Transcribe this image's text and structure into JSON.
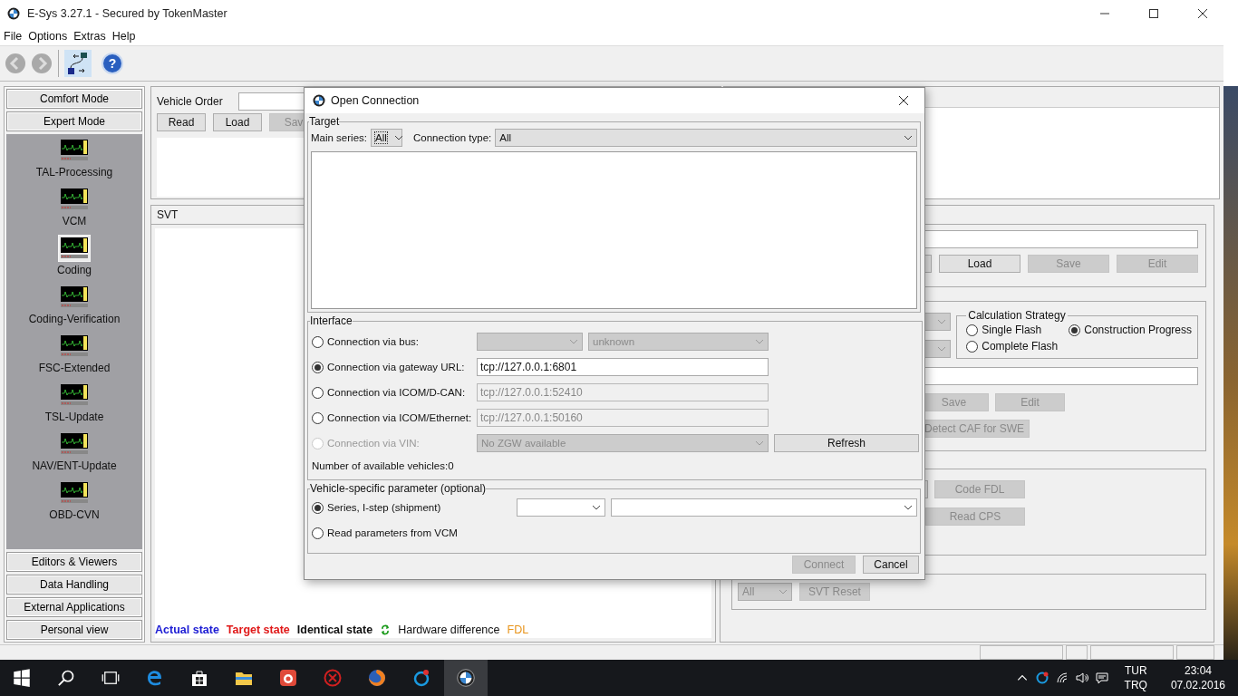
{
  "window": {
    "title": "E-Sys 3.27.1 - Secured by TokenMaster"
  },
  "menu": [
    "File",
    "Options",
    "Extras",
    "Help"
  ],
  "toolbar": {
    "help_glyph": "?"
  },
  "sidebar": {
    "top_buttons": [
      "Comfort Mode",
      "Expert Mode"
    ],
    "items": [
      {
        "label": "TAL-Processing",
        "selected": false
      },
      {
        "label": "VCM",
        "selected": false
      },
      {
        "label": "Coding",
        "selected": true
      },
      {
        "label": "Coding-Verification",
        "selected": false
      },
      {
        "label": "FSC-Extended",
        "selected": false
      },
      {
        "label": "TSL-Update",
        "selected": false
      },
      {
        "label": "NAV/ENT-Update",
        "selected": false
      },
      {
        "label": "OBD-CVN",
        "selected": false
      }
    ],
    "bottom_buttons": [
      "Editors & Viewers",
      "Data Handling",
      "External Applications",
      "Personal view"
    ]
  },
  "vehicle_order": {
    "label": "Vehicle Order",
    "buttons": [
      {
        "label": "Read",
        "disabled": false
      },
      {
        "label": "Load",
        "disabled": false
      },
      {
        "label": "Sav",
        "disabled": true
      }
    ]
  },
  "svt": {
    "title": "SVT",
    "legend": [
      {
        "kind": "state",
        "label": "Actual state",
        "color": "#1c1cd4"
      },
      {
        "kind": "state",
        "label": "Target state",
        "color": "#e01818"
      },
      {
        "kind": "state",
        "label": "Identical state",
        "color": "#111111"
      },
      {
        "kind": "icon",
        "label": "Hardware difference",
        "color": "#111111"
      },
      {
        "kind": "plain",
        "label": "FDL",
        "color": "#e8941a"
      }
    ]
  },
  "right_panel": {
    "file_buttons": [
      {
        "label": "Load",
        "disabled": false
      },
      {
        "label": "Save",
        "disabled": true
      },
      {
        "label": "Edit",
        "disabled": true
      }
    ],
    "calculation_strategy": {
      "title": "Calculation Strategy",
      "options": [
        {
          "label": "Single Flash",
          "selected": false
        },
        {
          "label": "Construction Progress",
          "selected": true
        },
        {
          "label": "Complete Flash",
          "selected": false
        }
      ]
    },
    "edit_buttons": [
      {
        "label": "Save",
        "disabled": true
      },
      {
        "label": "Edit",
        "disabled": true
      }
    ],
    "detect_button": {
      "label": "Detect CAF for SWE",
      "disabled": true
    },
    "coding_buttons": [
      {
        "label": "Code FDL",
        "disabled": true
      },
      {
        "label": "Read CPS",
        "disabled": true
      }
    ],
    "svt_filter": {
      "value": "All",
      "disabled": true
    },
    "svt_reset": {
      "label": "SVT Reset",
      "disabled": true
    }
  },
  "dialog": {
    "title": "Open Connection",
    "target": {
      "title": "Target",
      "main_series_label": "Main series:",
      "main_series": "All",
      "connection_type_label": "Connection type:",
      "connection_type": "All"
    },
    "interface": {
      "title": "Interface",
      "options": [
        {
          "kind": "bus",
          "label": "Connection via bus:",
          "selected": false,
          "disabled": false,
          "value": "unknown"
        },
        {
          "kind": "url",
          "label": "Connection via gateway URL:",
          "selected": true,
          "disabled": false,
          "value": "tcp://127.0.0.1:6801"
        },
        {
          "kind": "url",
          "label": "Connection via ICOM/D-CAN:",
          "selected": false,
          "disabled": false,
          "value": "tcp://127.0.0.1:52410"
        },
        {
          "kind": "url",
          "label": "Connection via ICOM/Ethernet:",
          "selected": false,
          "disabled": false,
          "value": "tcp://127.0.0.1:50160"
        },
        {
          "kind": "vin",
          "label": "Connection via VIN:",
          "selected": false,
          "disabled": true,
          "value": "No ZGW available"
        }
      ],
      "refresh": "Refresh",
      "count": "Number of available vehicles:0"
    },
    "vehicle_params": {
      "title": "Vehicle-specific parameter (optional)",
      "options": [
        {
          "kind": "series",
          "label": "Series, I-step (shipment)",
          "selected": true
        },
        {
          "kind": "plain",
          "label": "Read parameters from VCM",
          "selected": false
        }
      ]
    },
    "buttons": [
      {
        "label": "Connect",
        "disabled": true
      },
      {
        "label": "Cancel",
        "disabled": false
      }
    ]
  },
  "tray": {
    "language": "TUR",
    "keyboard": "TRQ",
    "time": "23:04",
    "date": "07.02.2016"
  }
}
